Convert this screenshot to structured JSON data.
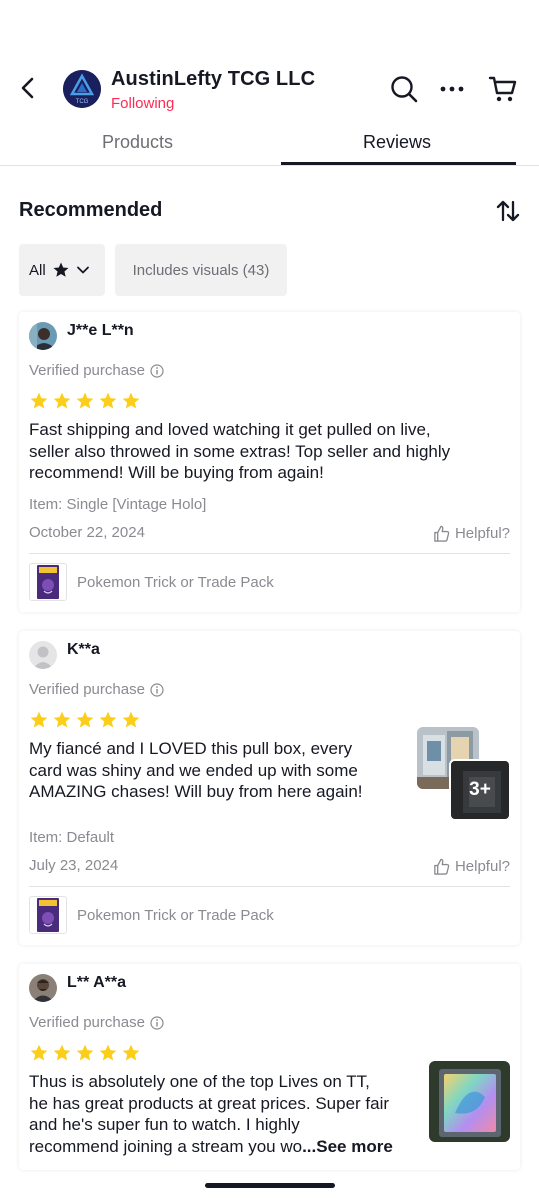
{
  "header": {
    "shop_name": "AustinLefty TCG LLC",
    "follow_status": "Following",
    "logo_text": "TCG",
    "accent_color": "#fe2c55"
  },
  "tabs": [
    {
      "label": "Products",
      "active": false
    },
    {
      "label": "Reviews",
      "active": true
    }
  ],
  "section": {
    "title": "Recommended"
  },
  "filters": {
    "rating": {
      "label": "All",
      "icon": "star-icon"
    },
    "visuals": {
      "label": "Includes visuals (43)"
    }
  },
  "reviews": [
    {
      "name": "J**e L**n",
      "verified": "Verified purchase",
      "rating": 5,
      "text": [
        "Fast shipping and loved watching it get pulled on live,",
        "seller also throwed in some extras! Top seller and highly",
        "recommend! Will be buying from again!"
      ],
      "item": "Item: Single [Vintage Holo]",
      "date": "October 22, 2024",
      "helpful": "Helpful?",
      "product": "Pokemon Trick or Trade Pack"
    },
    {
      "name": "K**a",
      "verified": "Verified purchase",
      "rating": 5,
      "text": [
        "My fiancé and I LOVED this pull box, every",
        "card was shiny and we ended up with some",
        "AMAZING chases! Will buy from here again!"
      ],
      "media_more": "3+",
      "item": "Item: Default",
      "date": "July 23, 2024",
      "helpful": "Helpful?",
      "product": "Pokemon Trick or Trade Pack"
    },
    {
      "name": "L** A**a",
      "verified": "Verified purchase",
      "rating": 5,
      "text": [
        "Thus is absolutely one of the top Lives on TT,",
        "he has great products at great prices. Super fair",
        "and he's super fun to watch. I highly",
        "recommend joining a stream you wo"
      ],
      "see_more": "...See more"
    }
  ],
  "colors": {
    "star": "#fcce1a",
    "text_primary": "#161823",
    "text_secondary": "#8a8b91"
  }
}
